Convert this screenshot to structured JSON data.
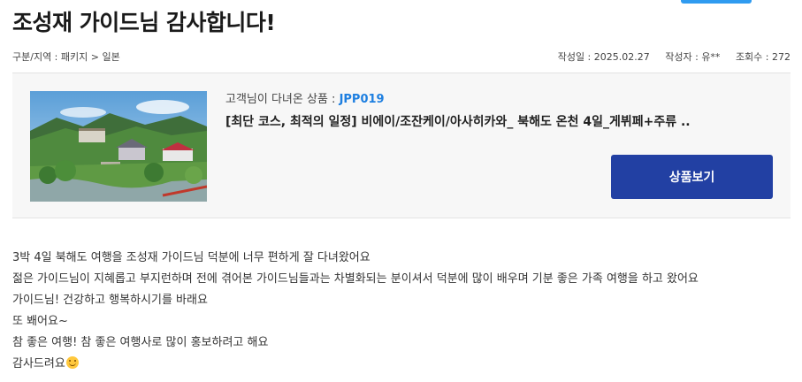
{
  "post": {
    "title": "조성재 가이드님 감사합니다!",
    "category": "구분/지역 : 패키지 > 일본",
    "date_label": "작성일 : ",
    "date": "2025.02.27",
    "author_label": "작성자 : ",
    "author": "유**",
    "views_label": "조회수 : ",
    "views": "272"
  },
  "product": {
    "code_label": "고객님이 다녀온 상품 : ",
    "code": "JPP019",
    "name": "[최단 코스, 최적의 일정] 비에이/조잔케이/아사히카와_ 북해도 온천 4일_게뷔페+주류 ..",
    "button_label": "상품보기",
    "image_icon": "hot-spring-landscape-photo"
  },
  "review": {
    "lines": [
      "3박 4일 북해도 여행을 조성재 가이드님 덕분에 너무 편하게 잘 다녀왔어요",
      "젊은 가이드님이 지혜롭고 부지런하며 전에 겪어본 가이드님들과는 차별화되는 분이셔서 덕분에 많이 배우며 기분 좋은 가족 여행을 하고 왔어요",
      "가이드님! 건강하고 행복하시기를 바래요",
      "또 봬어요~",
      "참 좋은 여행!  참 좋은 여행사로 많이 홍보하려고 해요",
      "감사드려요"
    ],
    "emoji": "smiling-face-icon"
  },
  "colors": {
    "accent_blue": "#1e7fe0",
    "button_navy": "#2240a3",
    "box_bg": "#f7f7f7"
  }
}
